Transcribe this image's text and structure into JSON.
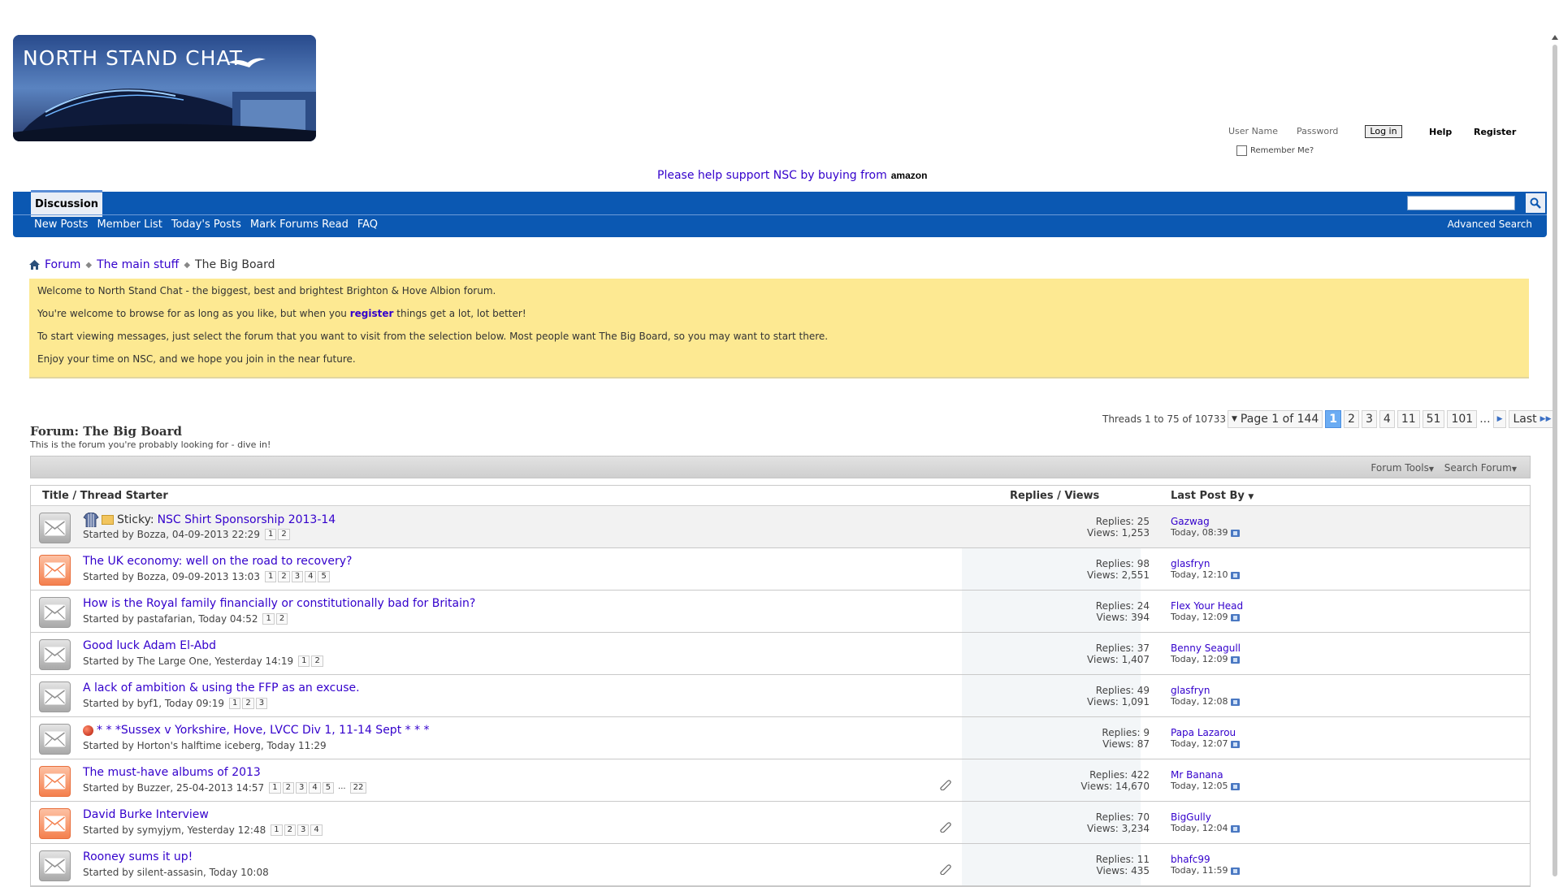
{
  "header": {
    "logo_text": "NORTH STAND CHAT",
    "login": {
      "username_label": "User Name",
      "password_label": "Password",
      "login_button": "Log in",
      "help": "Help",
      "register": "Register",
      "remember_me": "Remember Me?"
    },
    "support": {
      "text": "Please help support NSC by buying from",
      "brand": "amazon"
    }
  },
  "navbar": {
    "tab": "Discussion",
    "links": [
      "New Posts",
      "Member List",
      "Today's Posts",
      "Mark Forums Read",
      "FAQ"
    ],
    "advanced_search": "Advanced Search"
  },
  "breadcrumb": {
    "items": [
      "Forum",
      "The main stuff"
    ],
    "current": "The Big Board"
  },
  "notice": {
    "line1": "Welcome to North Stand Chat - the biggest, best and brightest Brighton & Hove Albion forum.",
    "line2_pre": "You're welcome to browse for as long as you like, but when you",
    "line2_link": "register",
    "line2_post": "things get a lot, lot better!",
    "line3": "To start viewing messages, just select the forum that you want to visit from the selection below. Most people want The Big Board, so you may want to start there.",
    "line4": "Enjoy your time on NSC, and we hope you join in the near future."
  },
  "forum": {
    "title": "Forum: The Big Board",
    "description": "This is the forum you're probably looking for - dive in!",
    "threads_count": "Threads 1 to 75 of 10733",
    "pagination": {
      "page_label": "Page 1 of 144",
      "pages": [
        "1",
        "2",
        "3",
        "4",
        "11",
        "51",
        "101"
      ],
      "ellipsis": "...",
      "last": "Last"
    },
    "tools": {
      "forum_tools": "Forum Tools",
      "search_forum": "Search Forum"
    }
  },
  "table": {
    "headers": {
      "title": "Title / Thread Starter",
      "replies_views": "Replies / Views",
      "last_post": "Last Post By"
    },
    "threads": [
      {
        "title": "NSC Shirt Sponsorship 2013-14",
        "prefix": "Sticky:",
        "starter": "Started by Bozza, 04-09-2013 22:29",
        "pages": [
          "1",
          "2"
        ],
        "replies": "Replies: 25",
        "views": "Views: 1,253",
        "last_user": "Gazwag",
        "last_time": "Today, 08:39",
        "hot": false
      },
      {
        "title": "The UK economy: well on the road to recovery?",
        "starter": "Started by Bozza, 09-09-2013 13:03",
        "pages": [
          "1",
          "2",
          "3",
          "4",
          "5"
        ],
        "replies": "Replies: 98",
        "views": "Views: 2,551",
        "last_user": "glasfryn",
        "last_time": "Today, 12:10",
        "hot": true
      },
      {
        "title": "How is the Royal family financially or constitutionally bad for Britain?",
        "starter": "Started by pastafarian, Today 04:52",
        "pages": [
          "1",
          "2"
        ],
        "replies": "Replies: 24",
        "views": "Views: 394",
        "last_user": "Flex Your Head",
        "last_time": "Today, 12:09",
        "hot": false
      },
      {
        "title": "Good luck Adam El-Abd",
        "starter": "Started by The Large One, Yesterday 14:19",
        "pages": [
          "1",
          "2"
        ],
        "replies": "Replies: 37",
        "views": "Views: 1,407",
        "last_user": "Benny Seagull",
        "last_time": "Today, 12:09",
        "hot": false
      },
      {
        "title": "A lack of ambition & using the FFP as an excuse.",
        "starter": "Started by byf1, Today 09:19",
        "pages": [
          "1",
          "2",
          "3"
        ],
        "replies": "Replies: 49",
        "views": "Views: 1,091",
        "last_user": "glasfryn",
        "last_time": "Today, 12:08",
        "hot": false
      },
      {
        "title": "* * *Sussex v Yorkshire, Hove, LVCC Div 1, 11-14 Sept * * *",
        "starter": "Started by Horton's halftime iceberg, Today 11:29",
        "pages": [],
        "replies": "Replies: 9",
        "views": "Views: 87",
        "last_user": "Papa Lazarou",
        "last_time": "Today, 12:07",
        "hot": false
      },
      {
        "title": "The must-have albums of 2013",
        "starter": "Started by Buzzer, 25-04-2013 14:57",
        "pages": [
          "1",
          "2",
          "3",
          "4",
          "5",
          "...",
          "22"
        ],
        "replies": "Replies: 422",
        "views": "Views: 14,670",
        "last_user": "Mr Banana",
        "last_time": "Today, 12:05",
        "hot": true
      },
      {
        "title": "David Burke Interview",
        "starter": "Started by symyjym, Yesterday 12:48",
        "pages": [
          "1",
          "2",
          "3",
          "4"
        ],
        "replies": "Replies: 70",
        "views": "Views: 3,234",
        "last_user": "BigGully",
        "last_time": "Today, 12:04",
        "hot": true
      },
      {
        "title": "Rooney sums it up!",
        "starter": "Started by silent-assasin, Today 10:08",
        "pages": [],
        "replies": "Replies: 11",
        "views": "Views: 435",
        "last_user": "bhafc99",
        "last_time": "Today, 11:59",
        "hot": false
      }
    ]
  },
  "colors": {
    "nav_blue": "#0b58b2",
    "link": "#3300cc",
    "notice_bg": "#fde992"
  }
}
